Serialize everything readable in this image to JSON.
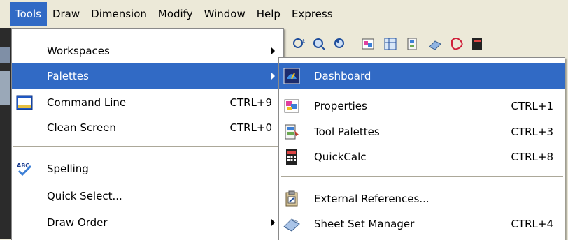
{
  "menubar": {
    "items": [
      "Tools",
      "Draw",
      "Dimension",
      "Modify",
      "Window",
      "Help",
      "Express"
    ]
  },
  "tools_menu": {
    "items": [
      {
        "label": "Workspaces",
        "has_submenu": true
      },
      {
        "label": "Palettes",
        "has_submenu": true,
        "highlighted": true
      },
      {
        "label": "Command Line",
        "shortcut": "CTRL+9",
        "icon": "command-line-icon"
      },
      {
        "label": "Clean Screen",
        "shortcut": "CTRL+0"
      },
      {
        "label": "Spelling",
        "icon": "spelling-icon"
      },
      {
        "label": "Quick Select..."
      },
      {
        "label": "Draw Order",
        "has_submenu": true
      }
    ]
  },
  "palettes_menu": {
    "items": [
      {
        "label": "Dashboard",
        "icon": "dashboard-icon",
        "highlighted": true
      },
      {
        "label": "Properties",
        "shortcut": "CTRL+1",
        "icon": "properties-icon"
      },
      {
        "label": "Tool Palettes",
        "shortcut": "CTRL+3",
        "icon": "tool-palettes-icon"
      },
      {
        "label": "QuickCalc",
        "shortcut": "CTRL+8",
        "icon": "calculator-icon"
      },
      {
        "label": "External References...",
        "icon": "external-references-icon"
      },
      {
        "label": "Sheet Set Manager",
        "shortcut": "CTRL+4",
        "icon": "sheet-set-manager-icon"
      }
    ]
  },
  "colors": {
    "highlight": "#316ac5",
    "menu_bg": "#ffffff",
    "chrome_bg": "#ece9d8"
  }
}
